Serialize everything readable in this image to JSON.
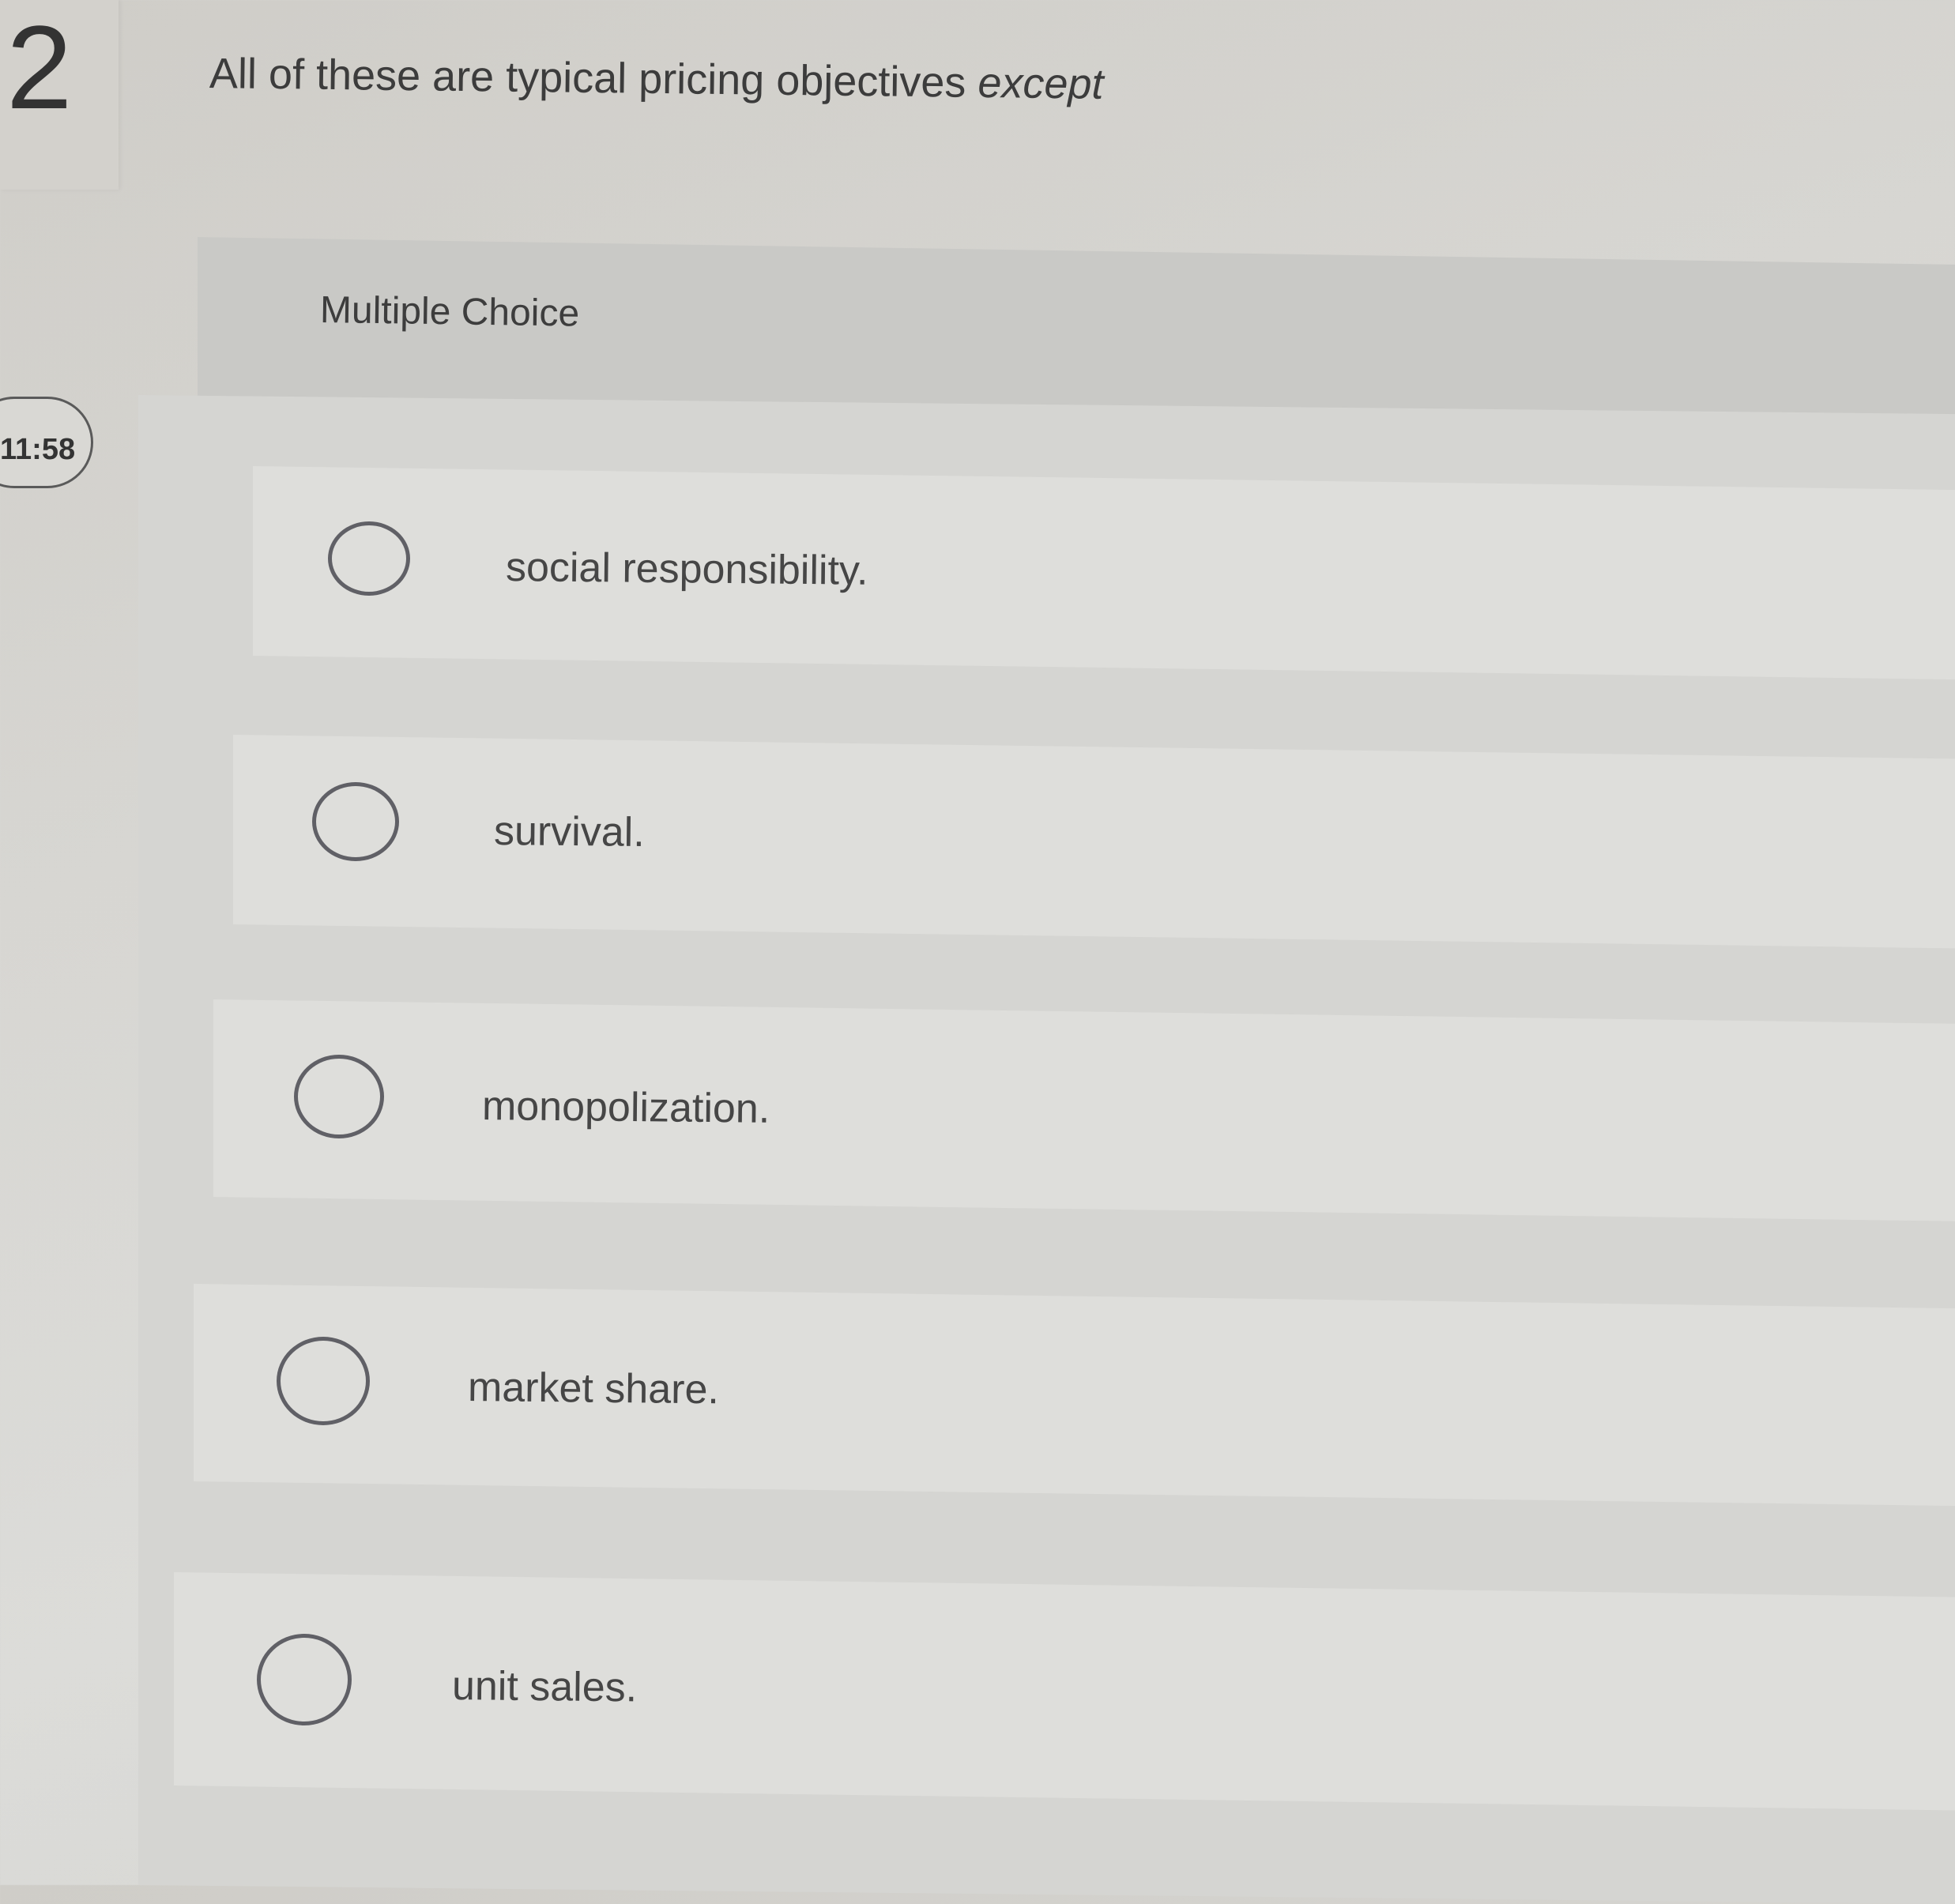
{
  "question": {
    "number": "2",
    "prompt_main": "All of these are typical pricing objectives ",
    "prompt_emphasis": "except"
  },
  "timer": {
    "value": "11:58"
  },
  "panel": {
    "type_label": "Multiple Choice"
  },
  "choices": [
    {
      "label": "social responsibility.",
      "selected": false
    },
    {
      "label": "survival.",
      "selected": false
    },
    {
      "label": "monopolization.",
      "selected": false
    },
    {
      "label": "market share.",
      "selected": false
    },
    {
      "label": "unit sales.",
      "selected": false
    }
  ],
  "colors": {
    "background": "#d6d5d1",
    "radio_border": "#606066",
    "text": "#464646"
  }
}
